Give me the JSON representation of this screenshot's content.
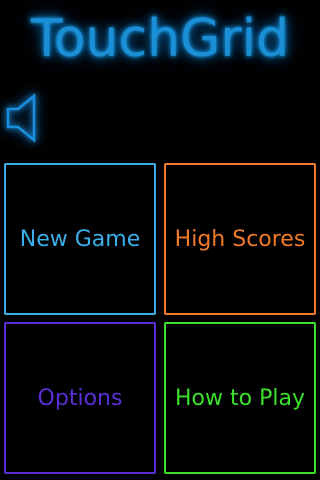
{
  "app": {
    "title": "TouchGrid"
  },
  "sound": {
    "icon": "speaker-icon",
    "color": "#1a8fe0"
  },
  "menu": {
    "new_game": {
      "label": "New Game",
      "color": "#3aaee8"
    },
    "high_scores": {
      "label": "High Scores",
      "color": "#f07a2a"
    },
    "options": {
      "label": "Options",
      "color": "#5a2fd6"
    },
    "how_to_play": {
      "label": "How to Play",
      "color": "#3ae02a"
    }
  }
}
